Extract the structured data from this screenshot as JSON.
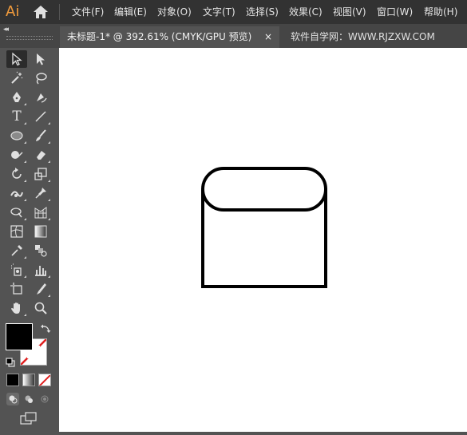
{
  "app": {
    "logo": "Ai"
  },
  "menu": [
    {
      "label": "文件(F)"
    },
    {
      "label": "编辑(E)"
    },
    {
      "label": "对象(O)"
    },
    {
      "label": "文字(T)"
    },
    {
      "label": "选择(S)"
    },
    {
      "label": "效果(C)"
    },
    {
      "label": "视图(V)"
    },
    {
      "label": "窗口(W)"
    },
    {
      "label": "帮助(H)"
    }
  ],
  "tabs": {
    "active": {
      "label": "未标题-1* @ 392.61% (CMYK/GPU 预览)",
      "close": "×"
    },
    "inactive": {
      "label": "软件自学网：WWW.RJZXW.COM"
    }
  },
  "toolbar": {
    "collapse": "◂◂",
    "type_tool_glyph": "T"
  },
  "colors": {
    "fill": "#000000",
    "stroke": "none",
    "accent_logo": "#f39c3c"
  }
}
